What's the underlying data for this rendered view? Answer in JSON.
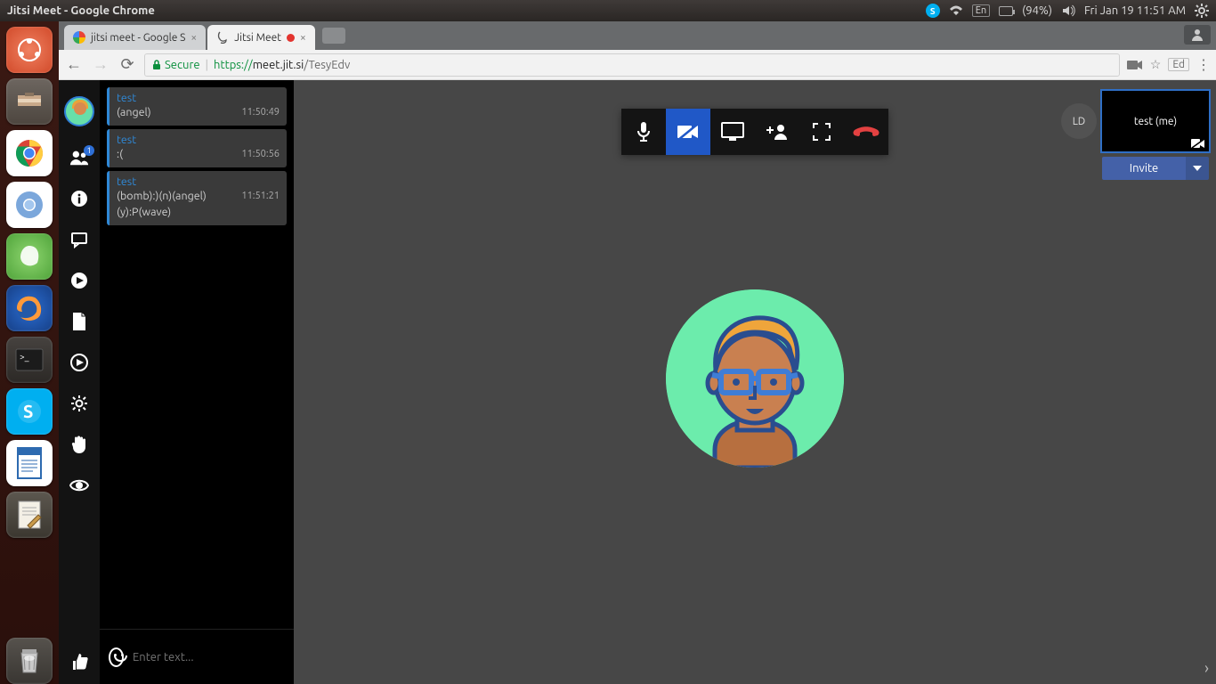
{
  "system": {
    "window_title": "Jitsi Meet - Google Chrome",
    "tray": {
      "language": "En",
      "battery": "(94%)",
      "datetime": "Fri Jan 19 11:51 AM"
    }
  },
  "browser": {
    "tabs": [
      {
        "title": "jitsi meet - Google S",
        "active": false
      },
      {
        "title": "Jitsi Meet",
        "active": true,
        "recording": true
      }
    ],
    "url_secure": "Secure",
    "url_proto": "https://",
    "url_host": "meet.jit.si",
    "url_path": "/TesyEdv",
    "profile": "Ed"
  },
  "jitsi": {
    "sidebar": {
      "contact_badge": "1"
    },
    "chat": {
      "messages": [
        {
          "sender": "test",
          "body": "(angel)",
          "time": "11:50:49"
        },
        {
          "sender": "test",
          "body": ":(",
          "time": "11:50:56"
        },
        {
          "sender": "test",
          "body": "(bomb):)(n)(angel)(y):P(wave)",
          "time": "11:51:21"
        }
      ],
      "input_placeholder": "Enter text..."
    },
    "participants": {
      "remote_initials": "LD",
      "self_label": "test (me)"
    },
    "invite_label": "Invite"
  }
}
